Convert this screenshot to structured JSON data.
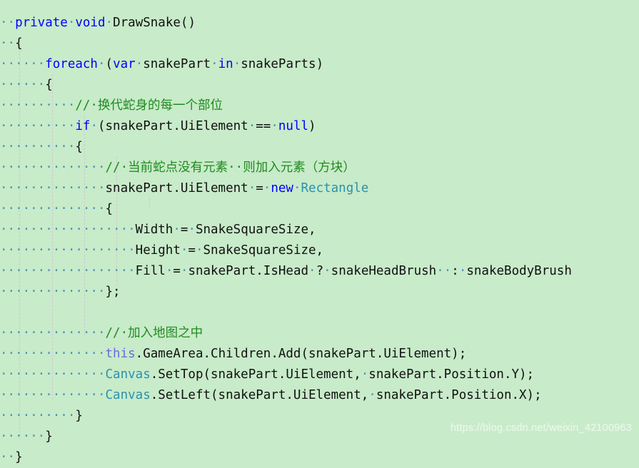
{
  "editor": {
    "background_color": "#c8ebc9",
    "whitespace_dot_color": "#4a90b8",
    "keyword_color": "#0000ff",
    "this_keyword_color": "#6a6ae0",
    "type_color": "#2b91af",
    "comment_color": "#1f8b1f",
    "text_color": "#111111",
    "indent_guide_color": "#cfc3cf",
    "language": "C#"
  },
  "watermark": {
    "text": "https://blog.csdn.net/weixin_42100963"
  },
  "code": {
    "lines": [
      {
        "id": "line-1",
        "tokens": [
          {
            "t": "ws",
            "v": "··"
          },
          {
            "t": "kw",
            "v": "private"
          },
          {
            "t": "ws",
            "v": "·"
          },
          {
            "t": "kw",
            "v": "void"
          },
          {
            "t": "ws",
            "v": "·"
          },
          {
            "t": "plain",
            "v": "DrawSnake()"
          }
        ]
      },
      {
        "id": "line-2",
        "tokens": [
          {
            "t": "ws",
            "v": "··"
          },
          {
            "t": "plain",
            "v": "{"
          }
        ]
      },
      {
        "id": "line-3",
        "tokens": [
          {
            "t": "ws",
            "v": "······"
          },
          {
            "t": "kw",
            "v": "foreach"
          },
          {
            "t": "ws",
            "v": "·"
          },
          {
            "t": "plain",
            "v": "("
          },
          {
            "t": "kw",
            "v": "var"
          },
          {
            "t": "ws",
            "v": "·"
          },
          {
            "t": "plain",
            "v": "snakePart"
          },
          {
            "t": "ws",
            "v": "·"
          },
          {
            "t": "kw",
            "v": "in"
          },
          {
            "t": "ws",
            "v": "·"
          },
          {
            "t": "plain",
            "v": "snakeParts)"
          }
        ]
      },
      {
        "id": "line-4",
        "tokens": [
          {
            "t": "ws",
            "v": "······"
          },
          {
            "t": "plain",
            "v": "{"
          }
        ]
      },
      {
        "id": "line-5",
        "tokens": [
          {
            "t": "ws",
            "v": "··········"
          },
          {
            "t": "cmt",
            "v": "//·换代蛇身的每一个部位"
          }
        ]
      },
      {
        "id": "line-6",
        "tokens": [
          {
            "t": "ws",
            "v": "··········"
          },
          {
            "t": "kw",
            "v": "if"
          },
          {
            "t": "ws",
            "v": "·"
          },
          {
            "t": "plain",
            "v": "(snakePart.UiElement"
          },
          {
            "t": "ws",
            "v": "·"
          },
          {
            "t": "plain",
            "v": "=="
          },
          {
            "t": "ws",
            "v": "·"
          },
          {
            "t": "kw",
            "v": "null"
          },
          {
            "t": "plain",
            "v": ")"
          }
        ]
      },
      {
        "id": "line-7",
        "tokens": [
          {
            "t": "ws",
            "v": "··········"
          },
          {
            "t": "plain",
            "v": "{"
          }
        ]
      },
      {
        "id": "line-8",
        "tokens": [
          {
            "t": "ws",
            "v": "··············"
          },
          {
            "t": "cmt",
            "v": "//·当前蛇点没有元素··则加入元素（方块）"
          }
        ]
      },
      {
        "id": "line-9",
        "tokens": [
          {
            "t": "ws",
            "v": "··············"
          },
          {
            "t": "plain",
            "v": "snakePart.UiElement"
          },
          {
            "t": "ws",
            "v": "·"
          },
          {
            "t": "plain",
            "v": "="
          },
          {
            "t": "ws",
            "v": "·"
          },
          {
            "t": "kw",
            "v": "new"
          },
          {
            "t": "ws",
            "v": "·"
          },
          {
            "t": "type",
            "v": "Rectangle"
          }
        ]
      },
      {
        "id": "line-10",
        "tokens": [
          {
            "t": "ws",
            "v": "··············"
          },
          {
            "t": "plain",
            "v": "{"
          }
        ]
      },
      {
        "id": "line-11",
        "tokens": [
          {
            "t": "ws",
            "v": "··················"
          },
          {
            "t": "plain",
            "v": "Width"
          },
          {
            "t": "ws",
            "v": "·"
          },
          {
            "t": "plain",
            "v": "="
          },
          {
            "t": "ws",
            "v": "·"
          },
          {
            "t": "plain",
            "v": "SnakeSquareSize,"
          }
        ]
      },
      {
        "id": "line-12",
        "tokens": [
          {
            "t": "ws",
            "v": "··················"
          },
          {
            "t": "plain",
            "v": "Height"
          },
          {
            "t": "ws",
            "v": "·"
          },
          {
            "t": "plain",
            "v": "="
          },
          {
            "t": "ws",
            "v": "·"
          },
          {
            "t": "plain",
            "v": "SnakeSquareSize,"
          }
        ]
      },
      {
        "id": "line-13",
        "tokens": [
          {
            "t": "ws",
            "v": "··················"
          },
          {
            "t": "plain",
            "v": "Fill"
          },
          {
            "t": "ws",
            "v": "·"
          },
          {
            "t": "plain",
            "v": "="
          },
          {
            "t": "ws",
            "v": "·"
          },
          {
            "t": "plain",
            "v": "snakePart.IsHead"
          },
          {
            "t": "ws",
            "v": "·"
          },
          {
            "t": "plain",
            "v": "?"
          },
          {
            "t": "ws",
            "v": "·"
          },
          {
            "t": "plain",
            "v": "snakeHeadBrush"
          },
          {
            "t": "ws",
            "v": "··"
          },
          {
            "t": "plain",
            "v": ":"
          },
          {
            "t": "ws",
            "v": "·"
          },
          {
            "t": "plain",
            "v": "snakeBodyBrush"
          }
        ]
      },
      {
        "id": "line-14",
        "tokens": [
          {
            "t": "ws",
            "v": "··············"
          },
          {
            "t": "plain",
            "v": "};"
          }
        ]
      },
      {
        "id": "line-15",
        "tokens": []
      },
      {
        "id": "line-16",
        "tokens": [
          {
            "t": "ws",
            "v": "··············"
          },
          {
            "t": "cmt",
            "v": "//·加入地图之中"
          }
        ]
      },
      {
        "id": "line-17",
        "tokens": [
          {
            "t": "ws",
            "v": "··············"
          },
          {
            "t": "kwthis",
            "v": "this"
          },
          {
            "t": "plain",
            "v": ".GameArea.Children.Add(snakePart.UiElement);"
          }
        ]
      },
      {
        "id": "line-18",
        "tokens": [
          {
            "t": "ws",
            "v": "··············"
          },
          {
            "t": "type",
            "v": "Canvas"
          },
          {
            "t": "plain",
            "v": ".SetTop(snakePart.UiElement,"
          },
          {
            "t": "ws",
            "v": "·"
          },
          {
            "t": "plain",
            "v": "snakePart.Position.Y);"
          }
        ]
      },
      {
        "id": "line-19",
        "tokens": [
          {
            "t": "ws",
            "v": "··············"
          },
          {
            "t": "type",
            "v": "Canvas"
          },
          {
            "t": "plain",
            "v": ".SetLeft(snakePart.UiElement,"
          },
          {
            "t": "ws",
            "v": "·"
          },
          {
            "t": "plain",
            "v": "snakePart.Position.X);"
          }
        ]
      },
      {
        "id": "line-20",
        "tokens": [
          {
            "t": "ws",
            "v": "··········"
          },
          {
            "t": "plain",
            "v": "}"
          }
        ]
      },
      {
        "id": "line-21",
        "tokens": [
          {
            "t": "ws",
            "v": "······"
          },
          {
            "t": "plain",
            "v": "}"
          }
        ]
      },
      {
        "id": "line-22",
        "tokens": [
          {
            "t": "ws",
            "v": "··"
          },
          {
            "t": "plain",
            "v": "}"
          }
        ]
      }
    ],
    "indent_guides_x": [
      27,
      73,
      118,
      163,
      209
    ]
  }
}
